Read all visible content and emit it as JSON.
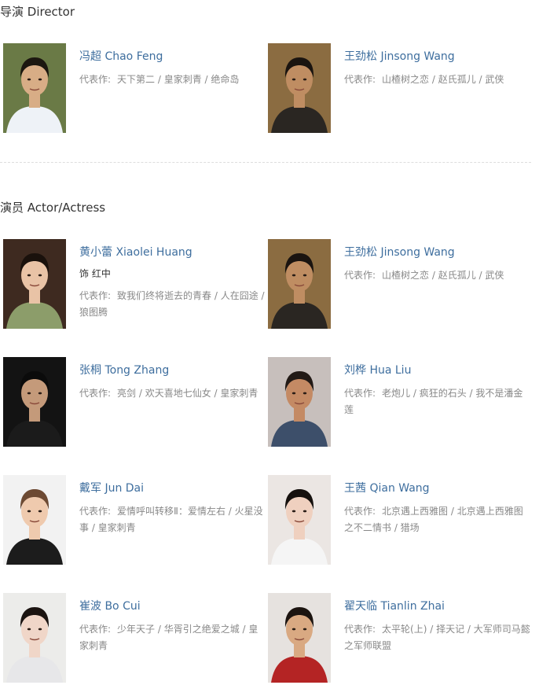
{
  "sections": {
    "director_title": "导演 Director",
    "actor_title": "演员 Actor/Actress"
  },
  "works_label": "代表作:",
  "directors": [
    {
      "name": "冯超 Chao Feng",
      "works": "天下第二 / 皇家刺青 / 绝命岛",
      "photo": {
        "bg": "#6a7a46",
        "skin": "#d8ad86",
        "hair": "#1c1710",
        "shirt": "#eef2f7"
      }
    },
    {
      "name": "王劲松 Jinsong Wang",
      "works": "山楂树之恋 / 赵氏孤儿 / 武侠",
      "photo": {
        "bg": "#8b6c41",
        "skin": "#bf8d62",
        "hair": "#1a1410",
        "shirt": "#2a2622"
      }
    }
  ],
  "actors": [
    {
      "name": "黄小蕾 Xiaolei Huang",
      "role": "饰 红中",
      "works": "致我们终将逝去的青春 / 人在囧途 / 狼图腾",
      "photo": {
        "bg": "#3e2a20",
        "skin": "#e9c3a6",
        "hair": "#1a110c",
        "shirt": "#8c9d6a"
      }
    },
    {
      "name": "王劲松 Jinsong Wang",
      "works": "山楂树之恋 / 赵氏孤儿 / 武侠",
      "photo": {
        "bg": "#8b6c41",
        "skin": "#bf8d62",
        "hair": "#1a1410",
        "shirt": "#2a2622"
      }
    },
    {
      "name": "张桐 Tong Zhang",
      "works": "亮剑 / 欢天喜地七仙女 / 皇家刺青",
      "photo": {
        "bg": "#131313",
        "skin": "#c49a7a",
        "hair": "#0b0b0b",
        "shirt": "#1b1b1b"
      }
    },
    {
      "name": "刘桦 Hua Liu",
      "works": "老炮儿 / 疯狂的石头 / 我不是潘金莲",
      "photo": {
        "bg": "#c7bfbc",
        "skin": "#c48a64",
        "hair": "#221a16",
        "shirt": "#3d4f6a"
      }
    },
    {
      "name": "戴军 Jun Dai",
      "works": "爱情呼叫转移Ⅱ：爱情左右 / 火星没事 / 皇家刺青",
      "photo": {
        "bg": "#f2f2f2",
        "skin": "#efcaae",
        "hair": "#6d4a33",
        "shirt": "#1c1c1c"
      }
    },
    {
      "name": "王茜 Qian Wang",
      "works": "北京遇上西雅图 / 北京遇上西雅图之不二情书 / 猎场",
      "photo": {
        "bg": "#ebe6e3",
        "skin": "#efd0bf",
        "hair": "#16110e",
        "shirt": "#f5f5f5"
      }
    },
    {
      "name": "崔波 Bo Cui",
      "works": "少年天子 / 华胥引之绝爱之城 / 皇家刺青",
      "photo": {
        "bg": "#ececea",
        "skin": "#f0d6c8",
        "hair": "#1b1411",
        "shirt": "#e7e7e9"
      }
    },
    {
      "name": "翟天临 Tianlin Zhai",
      "works": "太平轮(上) / 择天记 / 大军师司马懿之军师联盟",
      "photo": {
        "bg": "#e6e2df",
        "skin": "#d9a982",
        "hair": "#1c1410",
        "shirt": "#b42424"
      }
    }
  ]
}
